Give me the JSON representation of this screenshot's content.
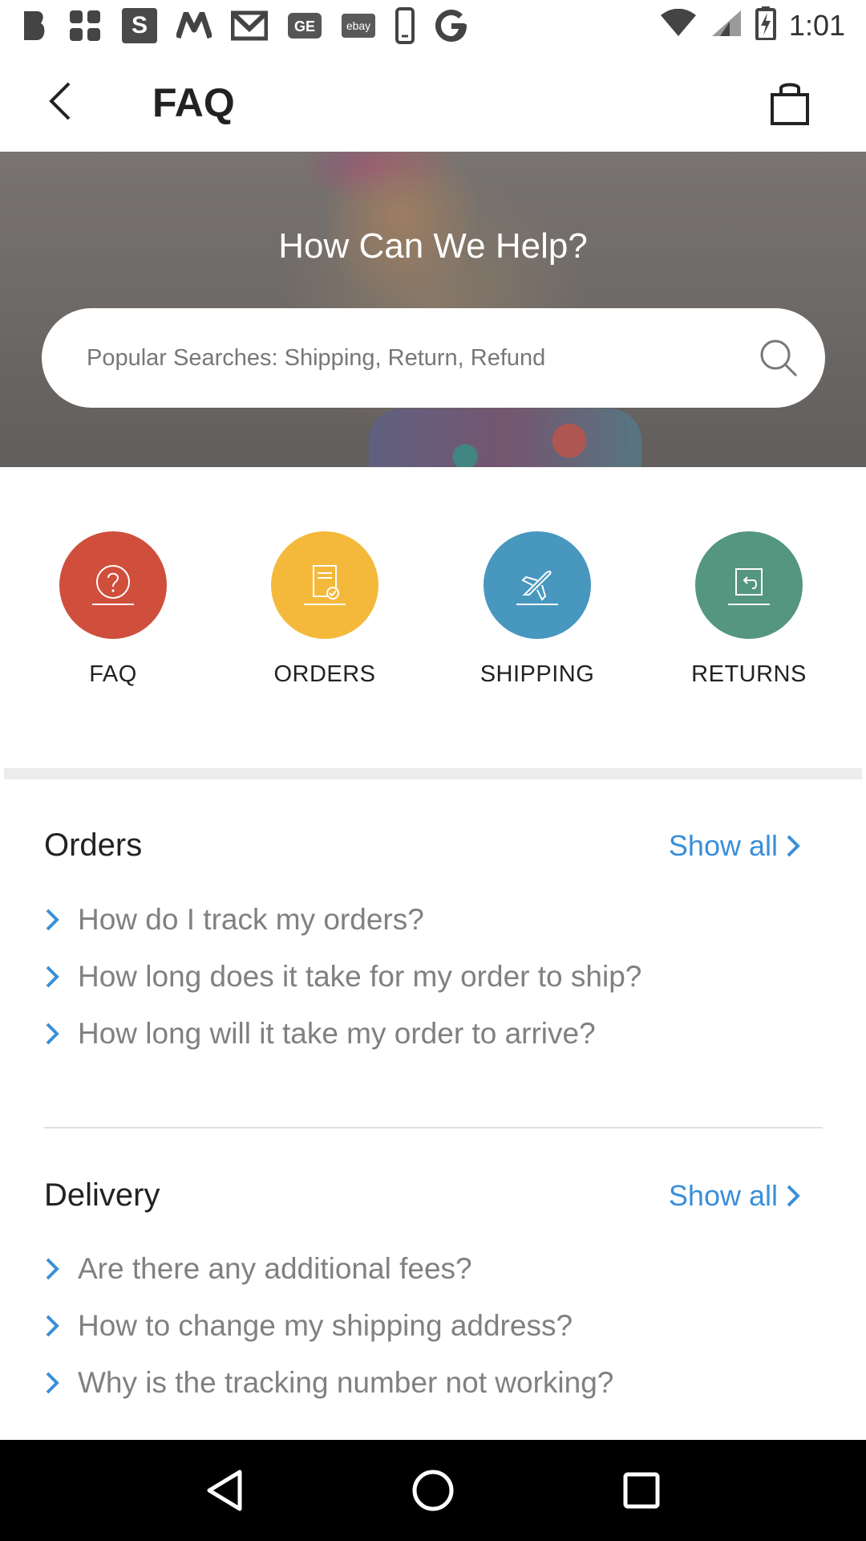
{
  "status_bar": {
    "time": "1:01",
    "icons": [
      "b-app-icon",
      "dropbox-icon",
      "s-app-icon",
      "m-app-icon",
      "gmail-icon",
      "ge-icon",
      "ebay-icon",
      "phone-icon",
      "google-icon"
    ],
    "ebay_text": "ebay"
  },
  "app_bar": {
    "title": "FAQ"
  },
  "hero": {
    "title": "How Can We Help?",
    "search_placeholder": "Popular Searches: Shipping, Return, Refund"
  },
  "categories": [
    {
      "label": "FAQ",
      "color": "#d04e3c",
      "icon": "question-icon"
    },
    {
      "label": "ORDERS",
      "color": "#f4b93b",
      "icon": "order-document-icon"
    },
    {
      "label": "SHIPPING",
      "color": "#4797bf",
      "icon": "airplane-icon"
    },
    {
      "label": "RETURNS",
      "color": "#549680",
      "icon": "return-box-icon"
    }
  ],
  "sections": [
    {
      "title": "Orders",
      "show_all": "Show all",
      "questions": [
        "How do I track my orders?",
        "How long does it take for my order to ship?",
        "How long will it take my order to arrive?"
      ]
    },
    {
      "title": "Delivery",
      "show_all": "Show all",
      "questions": [
        "Are there any additional fees?",
        "How to change my shipping address?",
        "Why is the tracking number not working?"
      ]
    }
  ],
  "colors": {
    "link_blue": "#3a8fd9",
    "question_gray": "#808080"
  }
}
